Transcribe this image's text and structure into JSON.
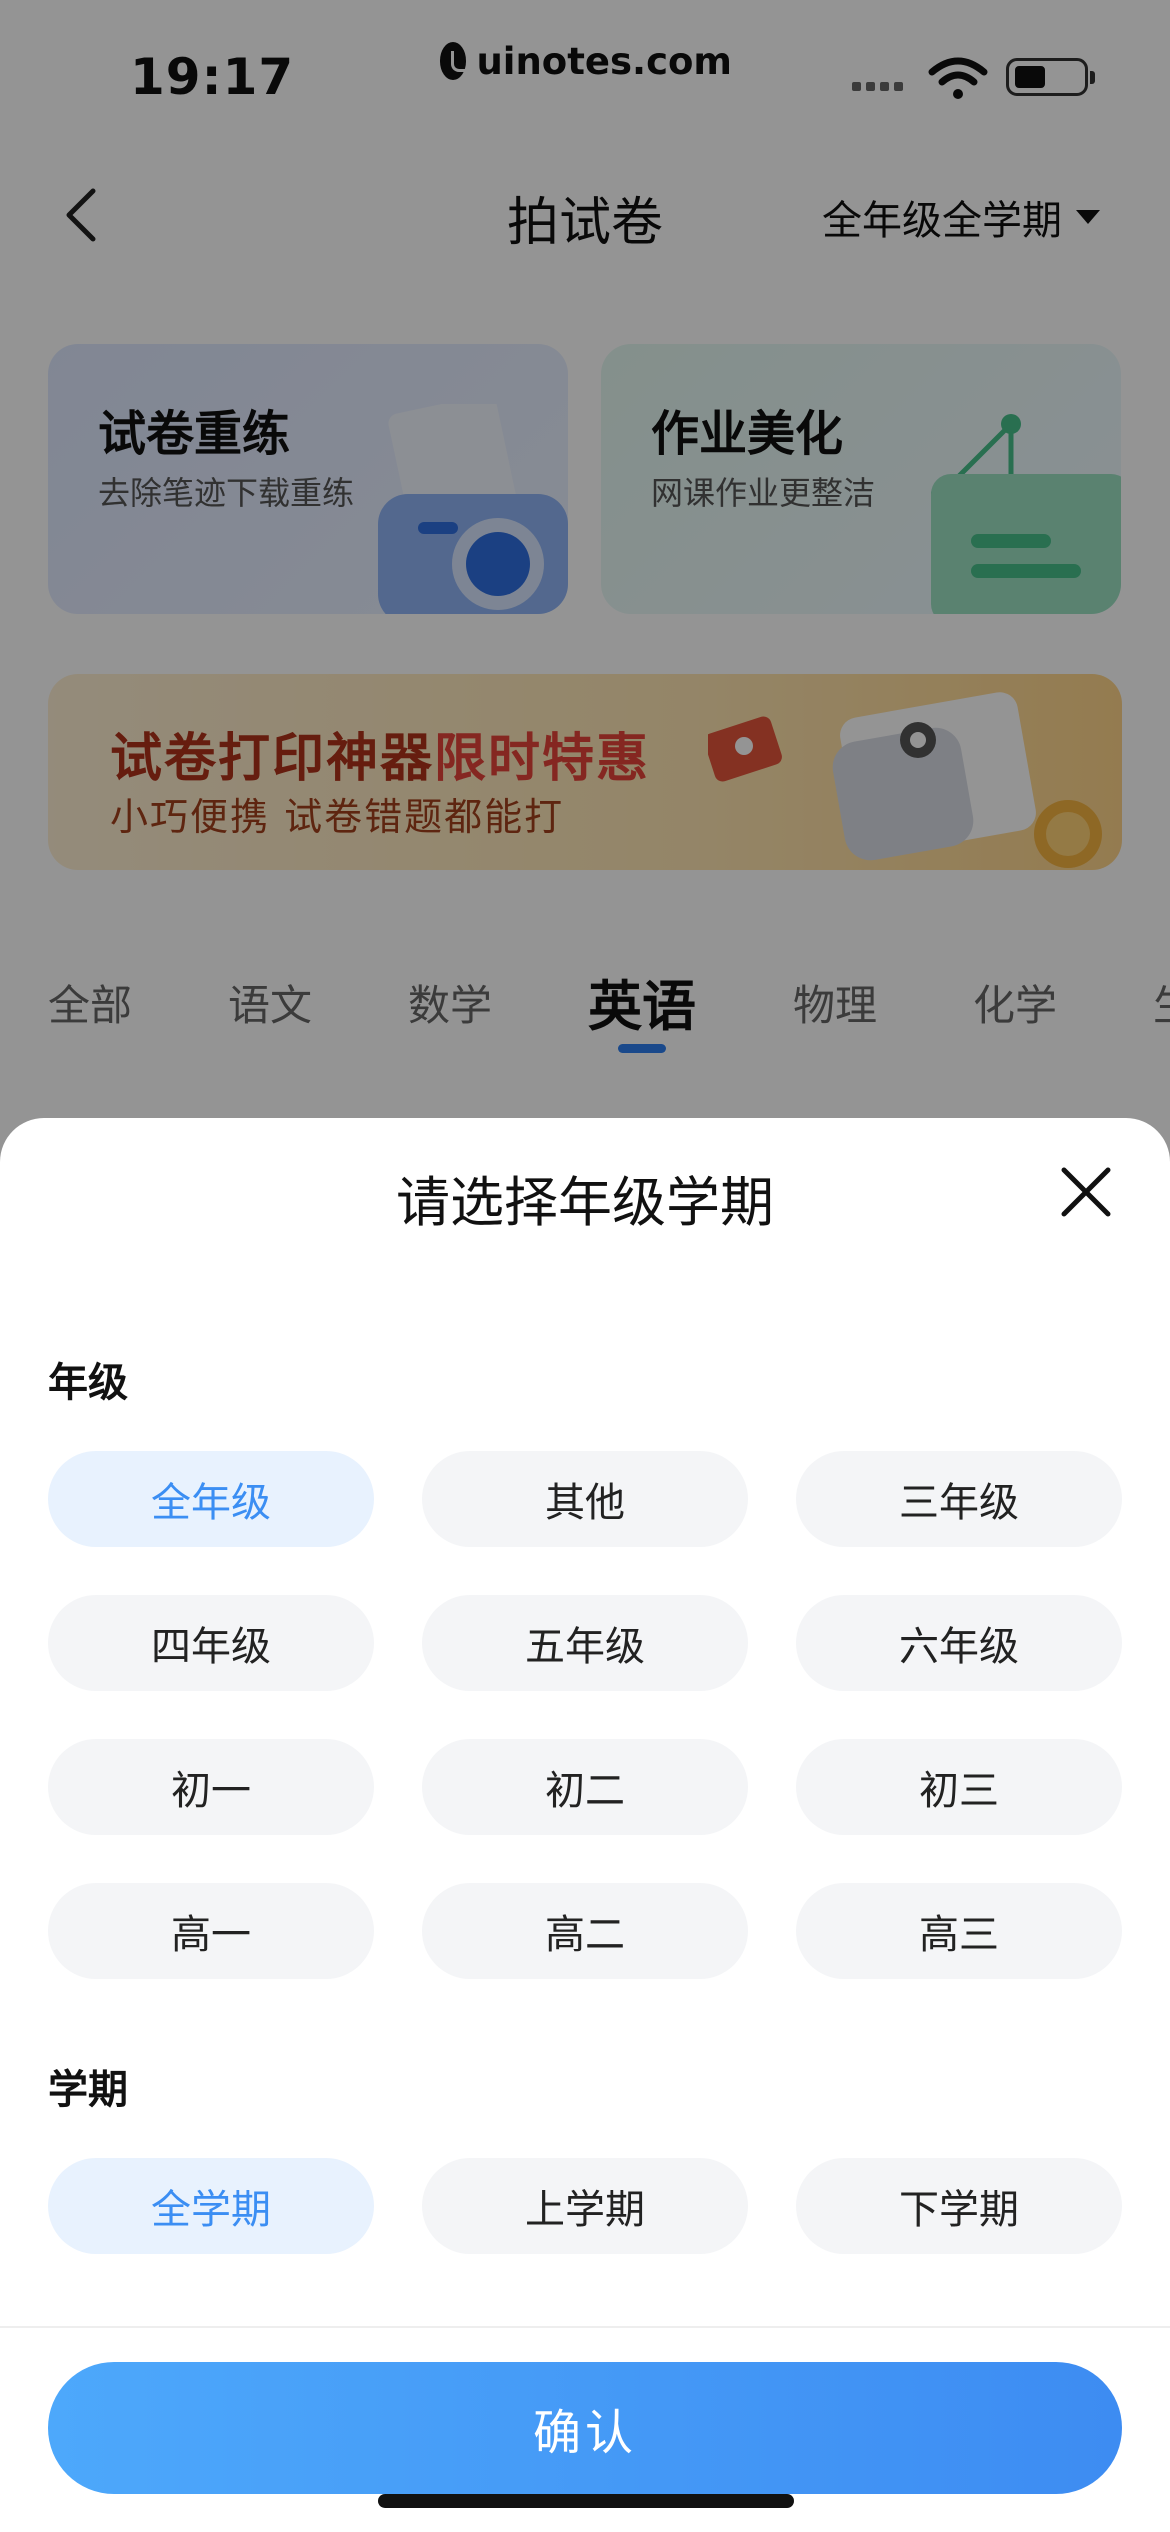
{
  "status_bar": {
    "time": "19:17",
    "site": "uinotes.com"
  },
  "nav": {
    "title": "拍试卷",
    "grade_filter": "全年级全学期"
  },
  "cards": [
    {
      "title": "试卷重练",
      "subtitle": "去除笔迹下载重练"
    },
    {
      "title": "作业美化",
      "subtitle": "网课作业更整洁"
    }
  ],
  "banner": {
    "title_main": "试卷打印神器",
    "title_highlight": "限时特惠",
    "subtitle": "小巧便携 试卷错题都能打"
  },
  "subject_tabs": [
    "全部",
    "语文",
    "数学",
    "英语",
    "物理",
    "化学",
    "生"
  ],
  "active_tab_index": 3,
  "sheet": {
    "title": "请选择年级学期",
    "grade_label": "年级",
    "grades": [
      "全年级",
      "其他",
      "三年级",
      "四年级",
      "五年级",
      "六年级",
      "初一",
      "初二",
      "初三",
      "高一",
      "高二",
      "高三"
    ],
    "selected_grade": "全年级",
    "term_label": "学期",
    "terms": [
      "全学期",
      "上学期",
      "下学期"
    ],
    "selected_term": "全学期",
    "confirm_label": "确认"
  },
  "colors": {
    "accent": "#3b8ef3",
    "selected_bg": "#e8f2fe",
    "option_bg": "#f4f5f7",
    "confirm_start": "#4da8fb",
    "confirm_end": "#3d8cf2"
  }
}
